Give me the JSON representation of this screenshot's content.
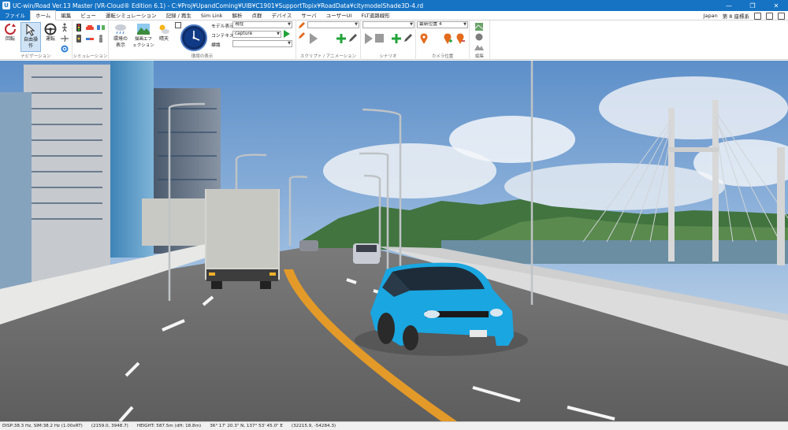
{
  "window": {
    "title": "UC-win/Road Ver.13 Master (VR-Cloud® Edition 6.1) - C:¥Proj¥UpandComing¥UIB¥C1901¥SupportTopix¥RoadData¥citymodelShade3D-4.rd",
    "app_icon_letter": "U",
    "minimize": "—",
    "maximize": "❐",
    "close": "✕"
  },
  "menu": {
    "tabs": [
      "ファイル",
      "ホーム",
      "編集",
      "ビュー",
      "運転シミュレーション",
      "記録 / 再生",
      "Sim Link",
      "解析",
      "点群",
      "デバイス",
      "サーバ",
      "ユーザーUI",
      "FLT道路線形"
    ],
    "active_index": 1,
    "right": {
      "region": "Japan",
      "coord_system": "第 8 座標系"
    }
  },
  "ribbon": {
    "navigation": {
      "label": "ナビゲーション",
      "rotate": "回転",
      "free_operation": "自由操\n作",
      "drive": "運転"
    },
    "simulation": {
      "label": "シミュレーション"
    },
    "environment": {
      "label": "環境の表示",
      "env_display": "環境の\n表示",
      "drawing_effect": "描画エフ\nェクション",
      "weather": "晴天",
      "model_display_label": "モデル表示",
      "model_display_value": "現在",
      "context_label": "コンテキスト",
      "context_value": "capture",
      "landmark_label": "標識",
      "landmark_value": ""
    },
    "script": {
      "label": "スクリプト / アニメーション",
      "value": ""
    },
    "scenario": {
      "label": "シナリオ",
      "value": ""
    },
    "camera": {
      "label": "カメラ位置",
      "value": "最新位置 4"
    },
    "edit": {
      "label": "編集"
    }
  },
  "status": {
    "fps": "DISP:38.3 Hz, SIM:38.2 Hz (1.00xRT)",
    "position": "(2159.0, 3948.7)",
    "height": "HEIGHT: 587.5m (dH: 18.8m)",
    "latlon": "36° 17' 20.3\" N, 137° 53' 45.0\" E",
    "coord": "(32215.9, -54284.3)"
  },
  "colors": {
    "titlebar": "#1673c4",
    "sky_top": "#5d8fc9",
    "asphalt": "#6d6d6d",
    "car_body": "#1aa6e0"
  }
}
